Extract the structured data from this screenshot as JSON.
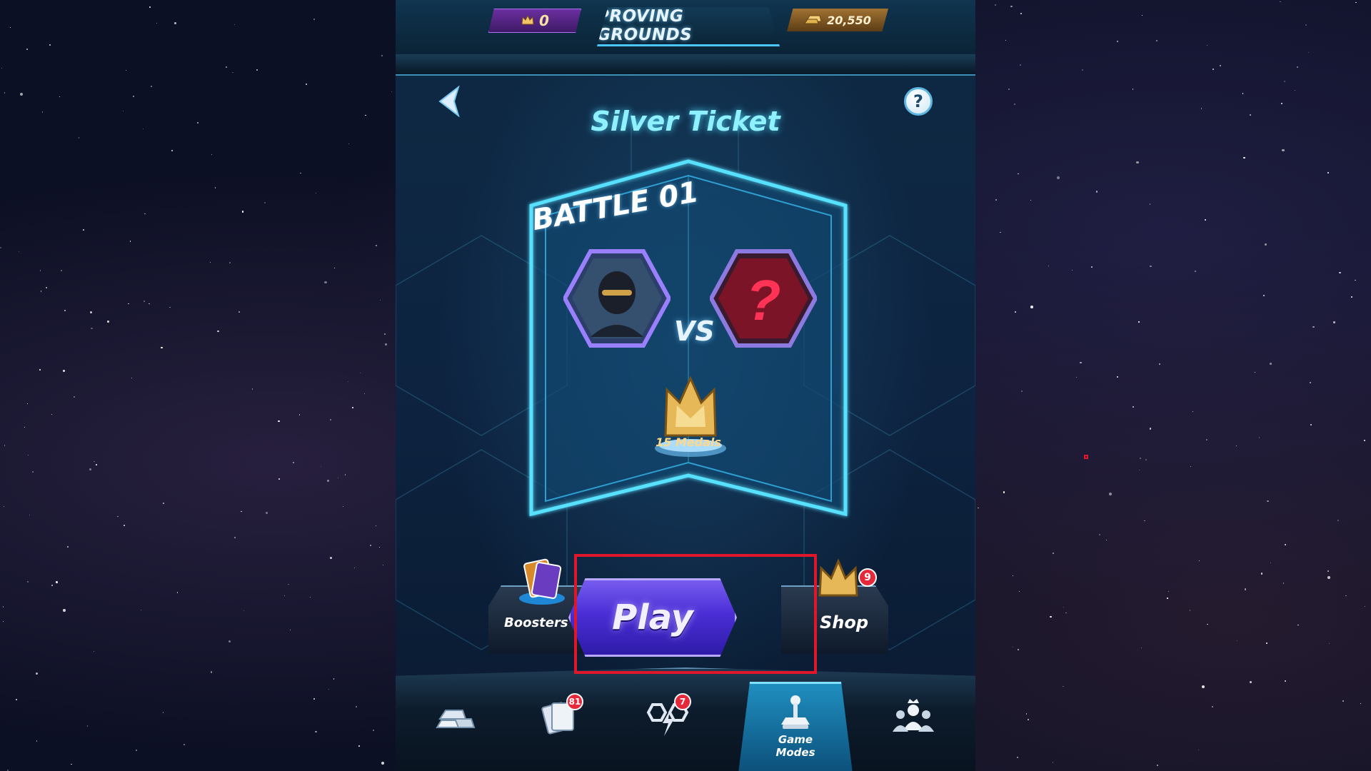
{
  "header": {
    "title": "PROVING GROUNDS",
    "medal_count": "0",
    "gold_count": "20,550"
  },
  "mode_title": "Silver Ticket",
  "battle": {
    "label": "BATTLE 01",
    "vs": "VS",
    "enemy_mark": "?",
    "reward": "15 Medals"
  },
  "actions": {
    "boosters_label": "Boosters",
    "play_label": "Play",
    "shop_label": "Shop",
    "shop_badge": "9"
  },
  "nav": {
    "items": [
      {
        "icon": "gold-bars-icon",
        "badge": ""
      },
      {
        "icon": "cards-icon",
        "badge": "81"
      },
      {
        "icon": "teams-icon",
        "badge": "7"
      },
      {
        "icon": "joystick-icon",
        "label_line1": "Game",
        "label_line2": "Modes"
      },
      {
        "icon": "alliance-icon",
        "badge": ""
      }
    ]
  },
  "help_label": "?",
  "colors": {
    "accent": "#4cc6ff",
    "play": "#4b2ed6",
    "highlight": "#e0162b",
    "badge": "#e5283a"
  }
}
